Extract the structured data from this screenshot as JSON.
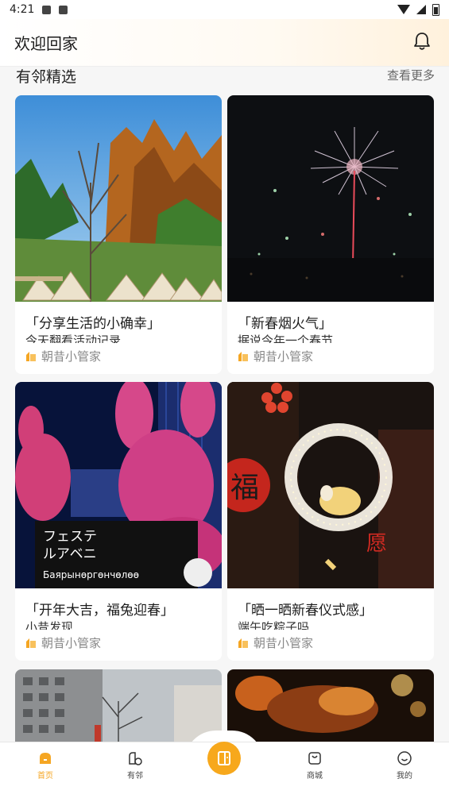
{
  "status_bar": {
    "time": "4:21"
  },
  "header": {
    "title": "欢迎回家",
    "icon": "bell-icon"
  },
  "section": {
    "title": "有邻精选",
    "more": "查看更多"
  },
  "cards": [
    {
      "title": "「分享生活的小确幸」",
      "subtitle": "今天翻看活动记录",
      "author": "朝昔小管家"
    },
    {
      "title": "「新春烟火气」",
      "subtitle": "据说今年一个春节",
      "author": "朝昔小管家"
    },
    {
      "title": "「开年大吉，福兔迎春」",
      "subtitle": "小昔发现",
      "author": "朝昔小管家"
    },
    {
      "title": "「晒一晒新春仪式感」",
      "subtitle": "端午吃粽子吗",
      "author": "朝昔小管家"
    }
  ],
  "image_text": {
    "sign_line1": "フェステ",
    "sign_line2": "ルアベニ",
    "sign_line3": "Баярынөргөнчөлөө",
    "red_char": "福",
    "wish_char": "愿"
  },
  "nav": [
    {
      "label": "首页",
      "icon": "home-icon",
      "active": true
    },
    {
      "label": "有邻",
      "icon": "neighbors-icon"
    },
    {
      "label": "",
      "icon": "center-action-icon"
    },
    {
      "label": "商城",
      "icon": "shop-bag-icon"
    },
    {
      "label": "我的",
      "icon": "profile-smile-icon"
    }
  ],
  "colors": {
    "accent": "#f7a81c",
    "author_icon": "#f5a623"
  }
}
